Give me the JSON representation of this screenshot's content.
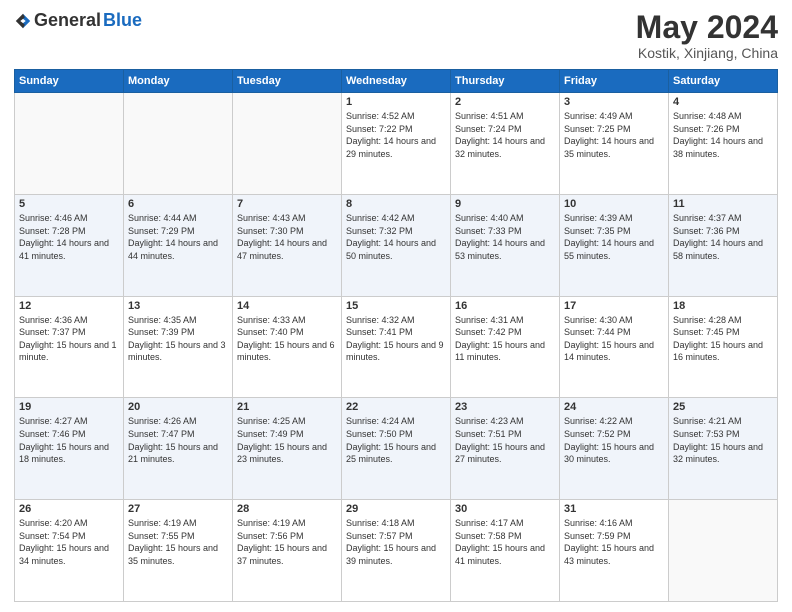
{
  "header": {
    "logo_general": "General",
    "logo_blue": "Blue",
    "month_title": "May 2024",
    "location": "Kostik, Xinjiang, China"
  },
  "weekdays": [
    "Sunday",
    "Monday",
    "Tuesday",
    "Wednesday",
    "Thursday",
    "Friday",
    "Saturday"
  ],
  "weeks": [
    [
      {
        "day": "",
        "sunrise": "",
        "sunset": "",
        "daylight": ""
      },
      {
        "day": "",
        "sunrise": "",
        "sunset": "",
        "daylight": ""
      },
      {
        "day": "",
        "sunrise": "",
        "sunset": "",
        "daylight": ""
      },
      {
        "day": "1",
        "sunrise": "Sunrise: 4:52 AM",
        "sunset": "Sunset: 7:22 PM",
        "daylight": "Daylight: 14 hours and 29 minutes."
      },
      {
        "day": "2",
        "sunrise": "Sunrise: 4:51 AM",
        "sunset": "Sunset: 7:24 PM",
        "daylight": "Daylight: 14 hours and 32 minutes."
      },
      {
        "day": "3",
        "sunrise": "Sunrise: 4:49 AM",
        "sunset": "Sunset: 7:25 PM",
        "daylight": "Daylight: 14 hours and 35 minutes."
      },
      {
        "day": "4",
        "sunrise": "Sunrise: 4:48 AM",
        "sunset": "Sunset: 7:26 PM",
        "daylight": "Daylight: 14 hours and 38 minutes."
      }
    ],
    [
      {
        "day": "5",
        "sunrise": "Sunrise: 4:46 AM",
        "sunset": "Sunset: 7:28 PM",
        "daylight": "Daylight: 14 hours and 41 minutes."
      },
      {
        "day": "6",
        "sunrise": "Sunrise: 4:44 AM",
        "sunset": "Sunset: 7:29 PM",
        "daylight": "Daylight: 14 hours and 44 minutes."
      },
      {
        "day": "7",
        "sunrise": "Sunrise: 4:43 AM",
        "sunset": "Sunset: 7:30 PM",
        "daylight": "Daylight: 14 hours and 47 minutes."
      },
      {
        "day": "8",
        "sunrise": "Sunrise: 4:42 AM",
        "sunset": "Sunset: 7:32 PM",
        "daylight": "Daylight: 14 hours and 50 minutes."
      },
      {
        "day": "9",
        "sunrise": "Sunrise: 4:40 AM",
        "sunset": "Sunset: 7:33 PM",
        "daylight": "Daylight: 14 hours and 53 minutes."
      },
      {
        "day": "10",
        "sunrise": "Sunrise: 4:39 AM",
        "sunset": "Sunset: 7:35 PM",
        "daylight": "Daylight: 14 hours and 55 minutes."
      },
      {
        "day": "11",
        "sunrise": "Sunrise: 4:37 AM",
        "sunset": "Sunset: 7:36 PM",
        "daylight": "Daylight: 14 hours and 58 minutes."
      }
    ],
    [
      {
        "day": "12",
        "sunrise": "Sunrise: 4:36 AM",
        "sunset": "Sunset: 7:37 PM",
        "daylight": "Daylight: 15 hours and 1 minute."
      },
      {
        "day": "13",
        "sunrise": "Sunrise: 4:35 AM",
        "sunset": "Sunset: 7:39 PM",
        "daylight": "Daylight: 15 hours and 3 minutes."
      },
      {
        "day": "14",
        "sunrise": "Sunrise: 4:33 AM",
        "sunset": "Sunset: 7:40 PM",
        "daylight": "Daylight: 15 hours and 6 minutes."
      },
      {
        "day": "15",
        "sunrise": "Sunrise: 4:32 AM",
        "sunset": "Sunset: 7:41 PM",
        "daylight": "Daylight: 15 hours and 9 minutes."
      },
      {
        "day": "16",
        "sunrise": "Sunrise: 4:31 AM",
        "sunset": "Sunset: 7:42 PM",
        "daylight": "Daylight: 15 hours and 11 minutes."
      },
      {
        "day": "17",
        "sunrise": "Sunrise: 4:30 AM",
        "sunset": "Sunset: 7:44 PM",
        "daylight": "Daylight: 15 hours and 14 minutes."
      },
      {
        "day": "18",
        "sunrise": "Sunrise: 4:28 AM",
        "sunset": "Sunset: 7:45 PM",
        "daylight": "Daylight: 15 hours and 16 minutes."
      }
    ],
    [
      {
        "day": "19",
        "sunrise": "Sunrise: 4:27 AM",
        "sunset": "Sunset: 7:46 PM",
        "daylight": "Daylight: 15 hours and 18 minutes."
      },
      {
        "day": "20",
        "sunrise": "Sunrise: 4:26 AM",
        "sunset": "Sunset: 7:47 PM",
        "daylight": "Daylight: 15 hours and 21 minutes."
      },
      {
        "day": "21",
        "sunrise": "Sunrise: 4:25 AM",
        "sunset": "Sunset: 7:49 PM",
        "daylight": "Daylight: 15 hours and 23 minutes."
      },
      {
        "day": "22",
        "sunrise": "Sunrise: 4:24 AM",
        "sunset": "Sunset: 7:50 PM",
        "daylight": "Daylight: 15 hours and 25 minutes."
      },
      {
        "day": "23",
        "sunrise": "Sunrise: 4:23 AM",
        "sunset": "Sunset: 7:51 PM",
        "daylight": "Daylight: 15 hours and 27 minutes."
      },
      {
        "day": "24",
        "sunrise": "Sunrise: 4:22 AM",
        "sunset": "Sunset: 7:52 PM",
        "daylight": "Daylight: 15 hours and 30 minutes."
      },
      {
        "day": "25",
        "sunrise": "Sunrise: 4:21 AM",
        "sunset": "Sunset: 7:53 PM",
        "daylight": "Daylight: 15 hours and 32 minutes."
      }
    ],
    [
      {
        "day": "26",
        "sunrise": "Sunrise: 4:20 AM",
        "sunset": "Sunset: 7:54 PM",
        "daylight": "Daylight: 15 hours and 34 minutes."
      },
      {
        "day": "27",
        "sunrise": "Sunrise: 4:19 AM",
        "sunset": "Sunset: 7:55 PM",
        "daylight": "Daylight: 15 hours and 35 minutes."
      },
      {
        "day": "28",
        "sunrise": "Sunrise: 4:19 AM",
        "sunset": "Sunset: 7:56 PM",
        "daylight": "Daylight: 15 hours and 37 minutes."
      },
      {
        "day": "29",
        "sunrise": "Sunrise: 4:18 AM",
        "sunset": "Sunset: 7:57 PM",
        "daylight": "Daylight: 15 hours and 39 minutes."
      },
      {
        "day": "30",
        "sunrise": "Sunrise: 4:17 AM",
        "sunset": "Sunset: 7:58 PM",
        "daylight": "Daylight: 15 hours and 41 minutes."
      },
      {
        "day": "31",
        "sunrise": "Sunrise: 4:16 AM",
        "sunset": "Sunset: 7:59 PM",
        "daylight": "Daylight: 15 hours and 43 minutes."
      },
      {
        "day": "",
        "sunrise": "",
        "sunset": "",
        "daylight": ""
      }
    ]
  ]
}
